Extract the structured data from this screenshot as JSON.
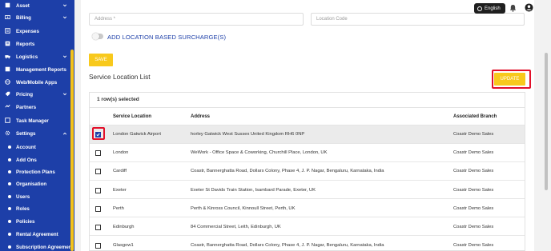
{
  "sidebar": {
    "items": [
      {
        "label": "Asset",
        "icon": "asset-icon",
        "chevron": true
      },
      {
        "label": "Billing",
        "icon": "billing-icon",
        "chevron": true
      },
      {
        "label": "Expenses",
        "icon": "expenses-icon",
        "chevron": false
      },
      {
        "label": "Reports",
        "icon": "reports-icon",
        "chevron": false
      },
      {
        "label": "Logistics",
        "icon": "logistics-icon",
        "chevron": true
      },
      {
        "label": "Management Reports",
        "icon": "management-reports-icon",
        "chevron": false
      },
      {
        "label": "Web/Mobile Apps",
        "icon": "apps-icon",
        "chevron": false
      },
      {
        "label": "Pricing",
        "icon": "pricing-icon",
        "chevron": true
      },
      {
        "label": "Partners",
        "icon": "partners-icon",
        "chevron": false
      },
      {
        "label": "Task Manager",
        "icon": "task-manager-icon",
        "chevron": false
      },
      {
        "label": "Settings",
        "icon": "gear-icon",
        "chevron": true,
        "expanded": true
      }
    ],
    "settings_subitems": [
      "Account",
      "Add Ons",
      "Protection Plans",
      "Organisation",
      "Users",
      "Roles",
      "Policies",
      "Rental Agreement",
      "Subscription Agreement"
    ],
    "color": "#1d3fa8",
    "scroll_accent": "#f3c21a"
  },
  "header": {
    "language_label": "English"
  },
  "form": {
    "address_placeholder": "Address *",
    "location_code_placeholder": "Location Code",
    "surcharge_toggle_label": "ADD LOCATION BASED SURCHARGE(S)",
    "surcharge_enabled": false,
    "save_label": "SAVE"
  },
  "list": {
    "title": "Service Location List",
    "update_label": "UPDATE",
    "selected_text": "1 row(s) selected",
    "columns": [
      "Service Location",
      "Address",
      "Associated Branch"
    ],
    "rows": [
      {
        "location": "London Gatwick Airport",
        "address": "horley Gatwick West Sussex United Kingdom RH6 0NP",
        "branch": "Coastr Demo Sales",
        "checked": true
      },
      {
        "location": "London",
        "address": "WeWork - Office Space & Coworking, Churchill Place, London, UK",
        "branch": "Coastr Demo Sales",
        "checked": false
      },
      {
        "location": "Cardiff",
        "address": "Coastr, Bannerghatta Road, Dollars Colony, Phase 4, J. P. Nagar, Bengaluru, Karnataka, India",
        "branch": "Coastr Demo Sales",
        "checked": false
      },
      {
        "location": "Exeter",
        "address": "Exeter St Davids Train Station, Isambard Parade, Exeter, UK",
        "branch": "Coastr Demo Sales",
        "checked": false
      },
      {
        "location": "Perth",
        "address": "Perth & Kinross Council, Kinnoull Street, Perth, UK",
        "branch": "Coastr Demo Sales",
        "checked": false
      },
      {
        "location": "Edinburgh",
        "address": "84 Commercial Street, Leith, Edinburgh, UK",
        "branch": "Coastr Demo Sales",
        "checked": false
      },
      {
        "location": "Glasgow1",
        "address": "Coastr, Bannerghatta Road, Dollars Colony, Phase 4, J. P. Nagar, Bengaluru, Karnataka, India",
        "branch": "Coastr Demo Sales",
        "checked": false
      }
    ]
  },
  "colors": {
    "accent_yellow": "#f8c91c",
    "highlight_red": "#e2102a",
    "brand_blue": "#1d3fa8"
  }
}
